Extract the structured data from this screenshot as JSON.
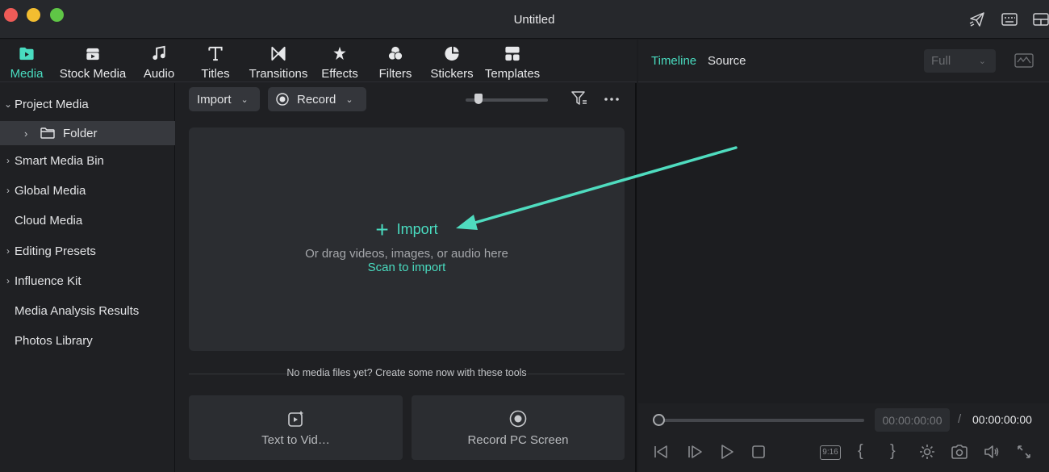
{
  "window": {
    "title": "Untitled"
  },
  "tabs": [
    {
      "label": "Media",
      "icon": "folder-media-icon",
      "active": true
    },
    {
      "label": "Stock Media",
      "icon": "stock-media-icon"
    },
    {
      "label": "Audio",
      "icon": "music-note-icon"
    },
    {
      "label": "Titles",
      "icon": "text-t-icon"
    },
    {
      "label": "Transitions",
      "icon": "transitions-icon"
    },
    {
      "label": "Effects",
      "icon": "effects-star-icon"
    },
    {
      "label": "Filters",
      "icon": "filters-circles-icon"
    },
    {
      "label": "Stickers",
      "icon": "sticker-icon"
    },
    {
      "label": "Templates",
      "icon": "templates-icon"
    }
  ],
  "sidebar": {
    "items": [
      {
        "label": "Project Media",
        "chevron": "down"
      },
      {
        "label": "Folder",
        "chevron": "right",
        "icon": "folder-icon",
        "selected": true
      },
      {
        "label": "Smart Media Bin",
        "chevron": "right"
      },
      {
        "label": "Global Media",
        "chevron": "right"
      },
      {
        "label": "Cloud Media",
        "chevron": ""
      },
      {
        "label": "Editing Presets",
        "chevron": "right"
      },
      {
        "label": "Influence Kit",
        "chevron": "right"
      },
      {
        "label": "Media Analysis Results",
        "chevron": ""
      },
      {
        "label": "Photos Library",
        "chevron": ""
      }
    ]
  },
  "media": {
    "import_button": "Import",
    "record_button": "Record",
    "dropzone": {
      "import_label": "Import",
      "drag_text": "Or drag videos, images, or audio here",
      "scan_link": "Scan to import"
    },
    "no_media_text": "No media files yet? Create some now with these tools",
    "tools": [
      {
        "label": "Text to Vid…",
        "icon": "text-to-video-icon"
      },
      {
        "label": "Record PC Screen",
        "icon": "record-screen-icon"
      }
    ]
  },
  "player": {
    "tabs": [
      {
        "label": "Timeline",
        "active": true
      },
      {
        "label": "Source",
        "active": false
      }
    ],
    "quality": "Full",
    "current_time": "00:00:00:00",
    "separator": "/",
    "total_time": "00:00:00:00",
    "aspect_label": "9:16"
  },
  "colors": {
    "accent": "#49dcc0",
    "annotation_arrow": "#4fdcbf"
  }
}
